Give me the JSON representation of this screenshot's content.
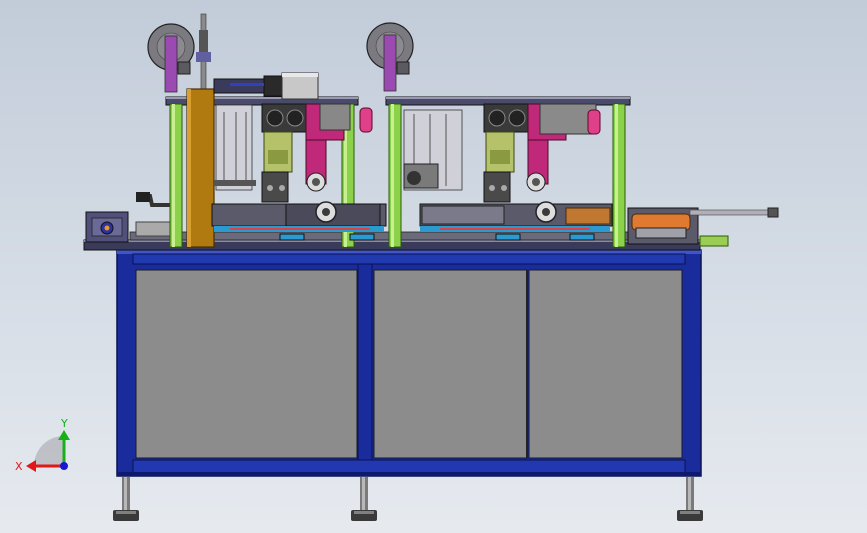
{
  "triad": {
    "x_label": "X",
    "y_label": "Y",
    "x_color": "#e01818",
    "y_color": "#18b018",
    "z_color": "#1818d0"
  },
  "colors": {
    "frame": "#1a2c9c",
    "panel": "#8c8c8c",
    "column": "#8bd14a",
    "plate": "#3a3a5a",
    "magenta": "#c0287a",
    "olive": "#b6c26a",
    "gold": "#b07a10"
  }
}
